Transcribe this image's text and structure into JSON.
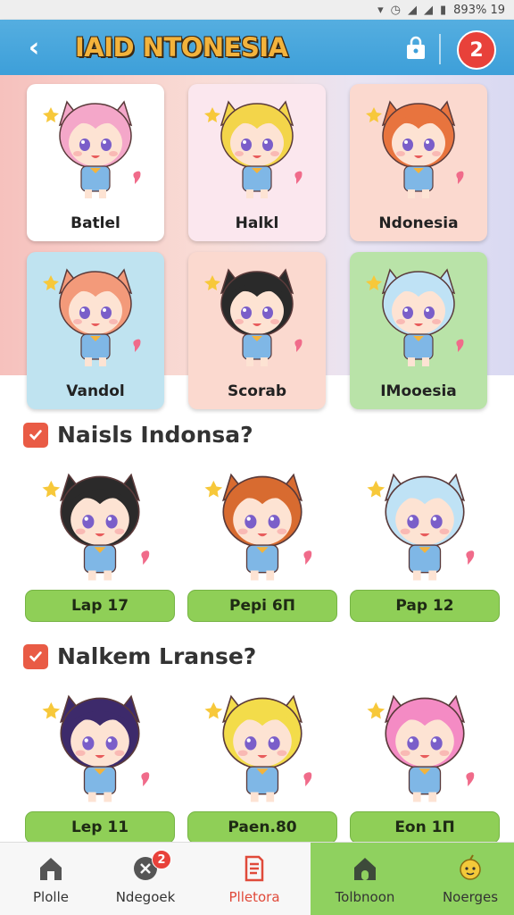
{
  "status_bar": {
    "time": "893% 19"
  },
  "header": {
    "title": "IAID NTONESIA",
    "notification_count": "2"
  },
  "featured": [
    {
      "label": "Batlel",
      "bg": "#ffffff",
      "hair": "#f4a7c9"
    },
    {
      "label": "Halkl",
      "bg": "#fbe7ee",
      "hair": "#f3d54a"
    },
    {
      "label": "Ndonesia",
      "bg": "#fbd9cf",
      "hair": "#e8743e"
    },
    {
      "label": "Vandol",
      "bg": "#bfe3f0",
      "hair": "#f39a7a"
    },
    {
      "label": "Scorab",
      "bg": "#fbd9cf",
      "hair": "#2a2a2a"
    },
    {
      "label": "IMooesia",
      "bg": "#b9e3a8",
      "hair": "#bfe2f5"
    }
  ],
  "section1": {
    "title": "Naisls Indonsa?",
    "items": [
      {
        "label": "Lap 17",
        "hair": "#2b2a2a"
      },
      {
        "label": "Pepi 6П",
        "hair": "#d86b30"
      },
      {
        "label": "Pap 12",
        "hair": "#bfe2f5"
      }
    ]
  },
  "section2": {
    "title": "Nalkem Lranse?",
    "items": [
      {
        "label": "Lep 11",
        "hair": "#3d2a6b"
      },
      {
        "label": "Paen.80",
        "hair": "#f3dc4a"
      },
      {
        "label": "Eon 1П",
        "hair": "#f48bc4"
      }
    ]
  },
  "bottom_nav": [
    {
      "label": "Plolle",
      "icon": "home-icon"
    },
    {
      "label": "Ndegoek",
      "icon": "search-icon",
      "badge": "2"
    },
    {
      "label": "Plletora",
      "icon": "list-icon"
    },
    {
      "label": "Tolbnoon",
      "icon": "home-icon"
    },
    {
      "label": "Noerges",
      "icon": "character-icon"
    }
  ]
}
